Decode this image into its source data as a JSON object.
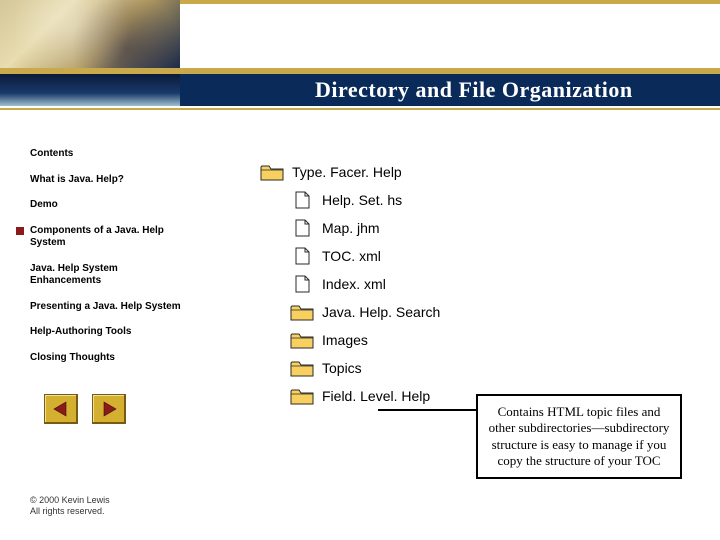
{
  "title": "Directory and File Organization",
  "sidebar": {
    "items": [
      {
        "label": "Contents",
        "active": false
      },
      {
        "label": "What is Java. Help?",
        "active": false
      },
      {
        "label": "Demo",
        "active": false
      },
      {
        "label": "Components of a Java. Help System",
        "active": true
      },
      {
        "label": "Java. Help System Enhancements",
        "active": false
      },
      {
        "label": "Presenting a Java. Help System",
        "active": false
      },
      {
        "label": "Help-Authoring Tools",
        "active": false
      },
      {
        "label": "Closing Thoughts",
        "active": false
      }
    ]
  },
  "tree": {
    "root": {
      "label": "Type. Facer. Help",
      "kind": "folder"
    },
    "children": [
      {
        "label": "Help. Set. hs",
        "kind": "file",
        "indent": 1
      },
      {
        "label": "Map. jhm",
        "kind": "file",
        "indent": 1
      },
      {
        "label": "TOC. xml",
        "kind": "file",
        "indent": 1
      },
      {
        "label": "Index. xml",
        "kind": "file",
        "indent": 1
      },
      {
        "label": "Java. Help. Search",
        "kind": "folder",
        "indent": 1
      },
      {
        "label": "Images",
        "kind": "folder",
        "indent": 1
      },
      {
        "label": "Topics",
        "kind": "folder",
        "indent": 1
      },
      {
        "label": "Field. Level. Help",
        "kind": "folder",
        "indent": 1
      }
    ]
  },
  "callout": "Contains HTML topic files and other subdirectories—subdirectory structure is easy to manage if you copy the structure of your TOC",
  "footer": {
    "line1": "© 2000 Kevin Lewis",
    "line2": "All rights reserved."
  },
  "icons": {
    "folder_fill": "#f8d060",
    "folder_stroke": "#2a2a2a",
    "file_stroke": "#2a2a2a",
    "arrow_fill": "#8b1a1a"
  }
}
